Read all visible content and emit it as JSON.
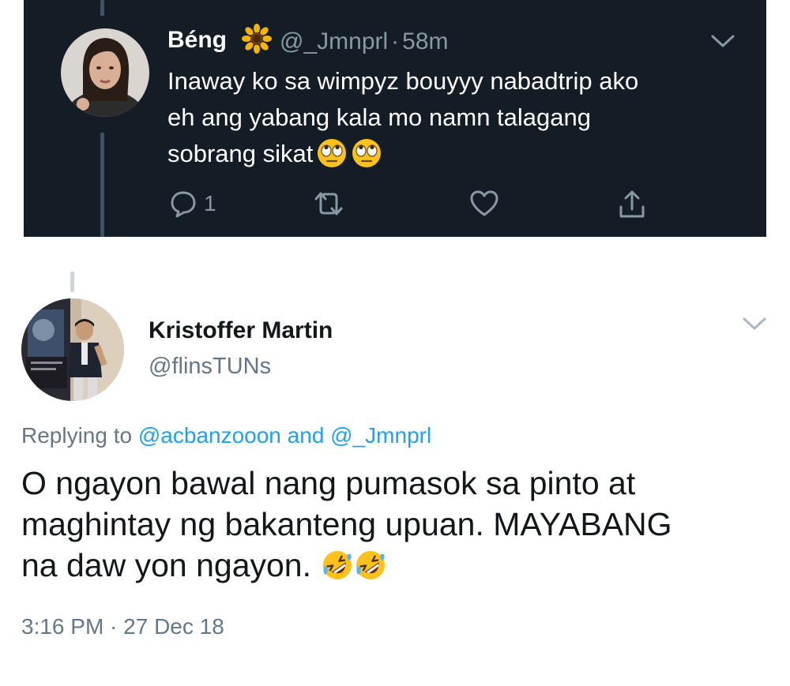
{
  "quoted_tweet": {
    "display_name": "Béng",
    "name_emoji": "sunflower-icon",
    "handle": "@_Jmnprl",
    "separator": "·",
    "time": "58m",
    "text_lines": [
      "Inaway ko sa wimpyz bouyyy nabadtrip ako",
      "eh ang yabang kala mo namn talagang",
      "sobrang sikat"
    ],
    "text_emoji": [
      "face-with-rolling-eyes-icon",
      "face-with-rolling-eyes-icon"
    ],
    "reply_count": "1",
    "actions": [
      "reply-icon",
      "retweet-icon",
      "like-icon",
      "share-icon"
    ],
    "colors": {
      "background": "#141d26",
      "text": "#ffffff",
      "muted": "#8899a6"
    }
  },
  "main_tweet": {
    "display_name": "Kristoffer Martin",
    "handle": "@flinsTUNs",
    "replying_prefix": "Replying to ",
    "reply_mention_1": "@acbanzooon",
    "reply_joiner": " and ",
    "reply_mention_2": "@_Jmnprl",
    "text_lines": [
      "O ngayon bawal nang pumasok sa pinto at",
      "maghintay ng bakanteng upuan. MAYABANG",
      "na daw yon ngayon."
    ],
    "text_emoji": [
      "rolling-on-floor-laughing-icon",
      "rolling-on-floor-laughing-icon"
    ],
    "timestamp": "3:16 PM · 27 Dec 18",
    "colors": {
      "text": "#14171a",
      "muted": "#657786",
      "link": "#1da1f2"
    }
  }
}
